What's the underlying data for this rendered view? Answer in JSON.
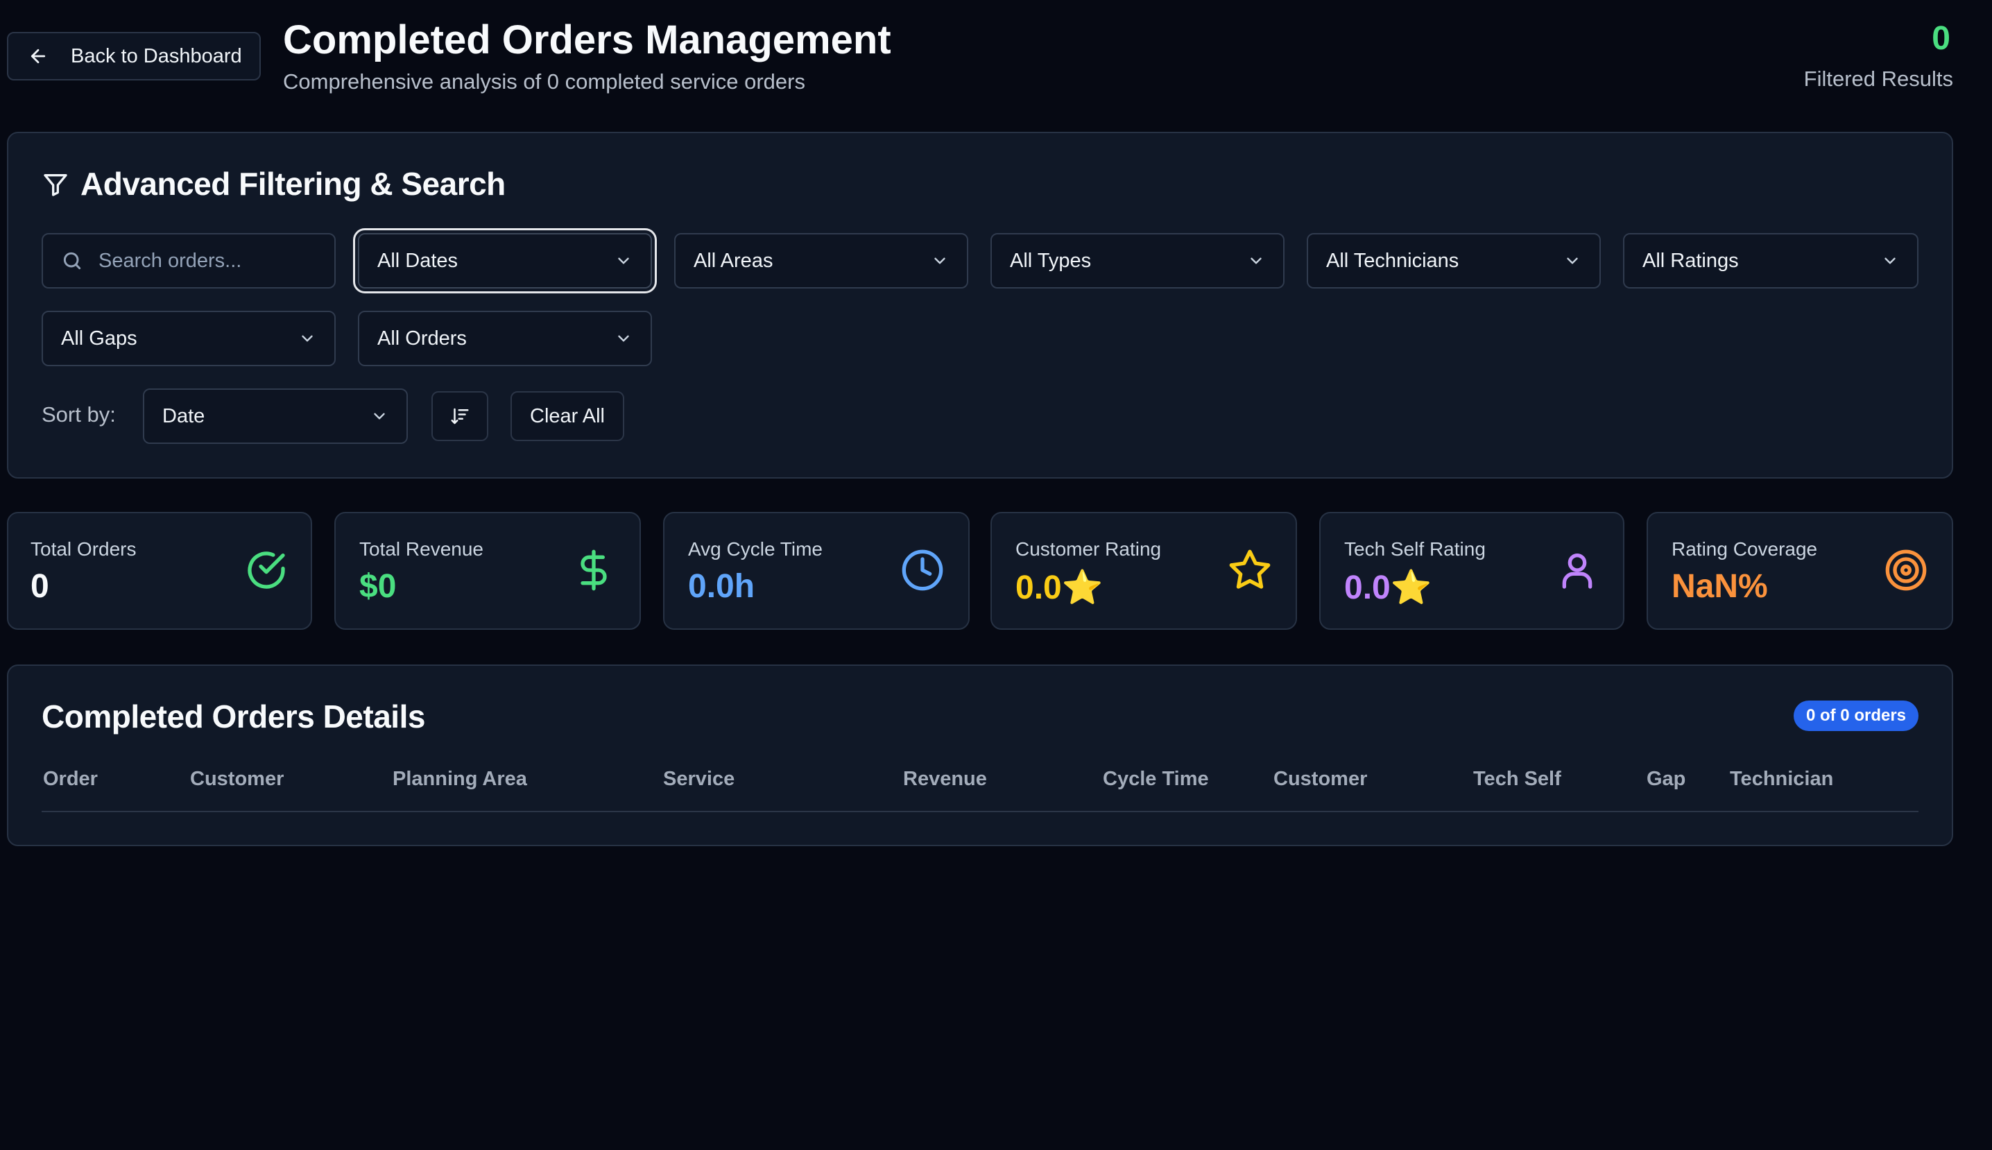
{
  "header": {
    "back_label": "Back to Dashboard",
    "title": "Completed Orders Management",
    "subtitle": "Comprehensive analysis of 0 completed service orders",
    "filtered_count": "0",
    "filtered_label": "Filtered Results"
  },
  "filters": {
    "title": "Advanced Filtering & Search",
    "search_placeholder": "Search orders...",
    "dates": "All Dates",
    "areas": "All Areas",
    "types": "All Types",
    "technicians": "All Technicians",
    "ratings": "All Ratings",
    "gaps": "All Gaps",
    "orders": "All Orders",
    "sort_label": "Sort by:",
    "sort_value": "Date",
    "clear_label": "Clear All"
  },
  "stats": [
    {
      "label": "Total Orders",
      "value": "0",
      "color": "#f8fafc",
      "icon": "check-circle-icon",
      "icon_color": "#4ade80"
    },
    {
      "label": "Total Revenue",
      "value": "$0",
      "color": "#4ade80",
      "icon": "dollar-icon",
      "icon_color": "#4ade80"
    },
    {
      "label": "Avg Cycle Time",
      "value": "0.0h",
      "color": "#60a5fa",
      "icon": "clock-icon",
      "icon_color": "#60a5fa"
    },
    {
      "label": "Customer Rating",
      "value": "0.0⭐",
      "color": "#facc15",
      "icon": "star-icon",
      "icon_color": "#facc15"
    },
    {
      "label": "Tech Self Rating",
      "value": "0.0⭐",
      "color": "#c084fc",
      "icon": "user-icon",
      "icon_color": "#c084fc"
    },
    {
      "label": "Rating Coverage",
      "value": "NaN%",
      "color": "#fb923c",
      "icon": "target-icon",
      "icon_color": "#fb923c"
    }
  ],
  "table": {
    "title": "Completed Orders Details",
    "badge": "0 of 0 orders",
    "columns": [
      "Order",
      "Customer",
      "Planning Area",
      "Service",
      "Revenue",
      "Cycle Time",
      "Customer",
      "Tech Self",
      "Gap",
      "Technician"
    ]
  }
}
